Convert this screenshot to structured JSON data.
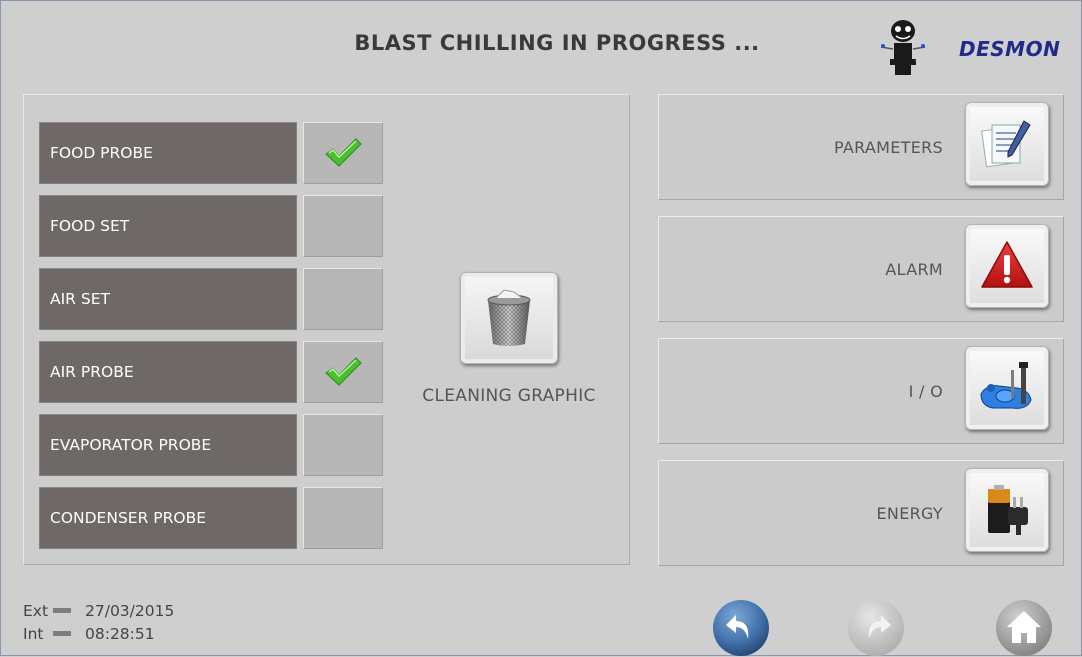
{
  "header": {
    "title": "BLAST CHILLING IN PROGRESS ...",
    "brand": "DESMON"
  },
  "probes": [
    {
      "label": "FOOD PROBE",
      "checked": true
    },
    {
      "label": "FOOD SET",
      "checked": false
    },
    {
      "label": "AIR SET",
      "checked": false
    },
    {
      "label": "AIR PROBE",
      "checked": true
    },
    {
      "label": "EVAPORATOR PROBE",
      "checked": false
    },
    {
      "label": "CONDENSER PROBE",
      "checked": false
    }
  ],
  "cleaning": {
    "label": "CLEANING GRAPHIC",
    "icon": "trash-basket-icon"
  },
  "menu": [
    {
      "label": "PARAMETERS",
      "icon": "documents-pen-icon"
    },
    {
      "label": "ALARM",
      "icon": "warning-triangle-icon"
    },
    {
      "label": "I / O",
      "icon": "io-tools-icon"
    },
    {
      "label": "ENERGY",
      "icon": "battery-plug-icon"
    }
  ],
  "status": {
    "ext_label": "Ext",
    "int_label": "Int",
    "date": "27/03/2015",
    "time": "08:28:51"
  },
  "nav": {
    "back_icon": "back-arrow-icon",
    "forward_icon": "forward-arrow-icon",
    "home_icon": "home-icon"
  },
  "colors": {
    "brand": "#1f2a8a",
    "probe_label_bg": "#6e6967",
    "check_green": "#4cbf2e",
    "alarm_red": "#d41c1c"
  }
}
